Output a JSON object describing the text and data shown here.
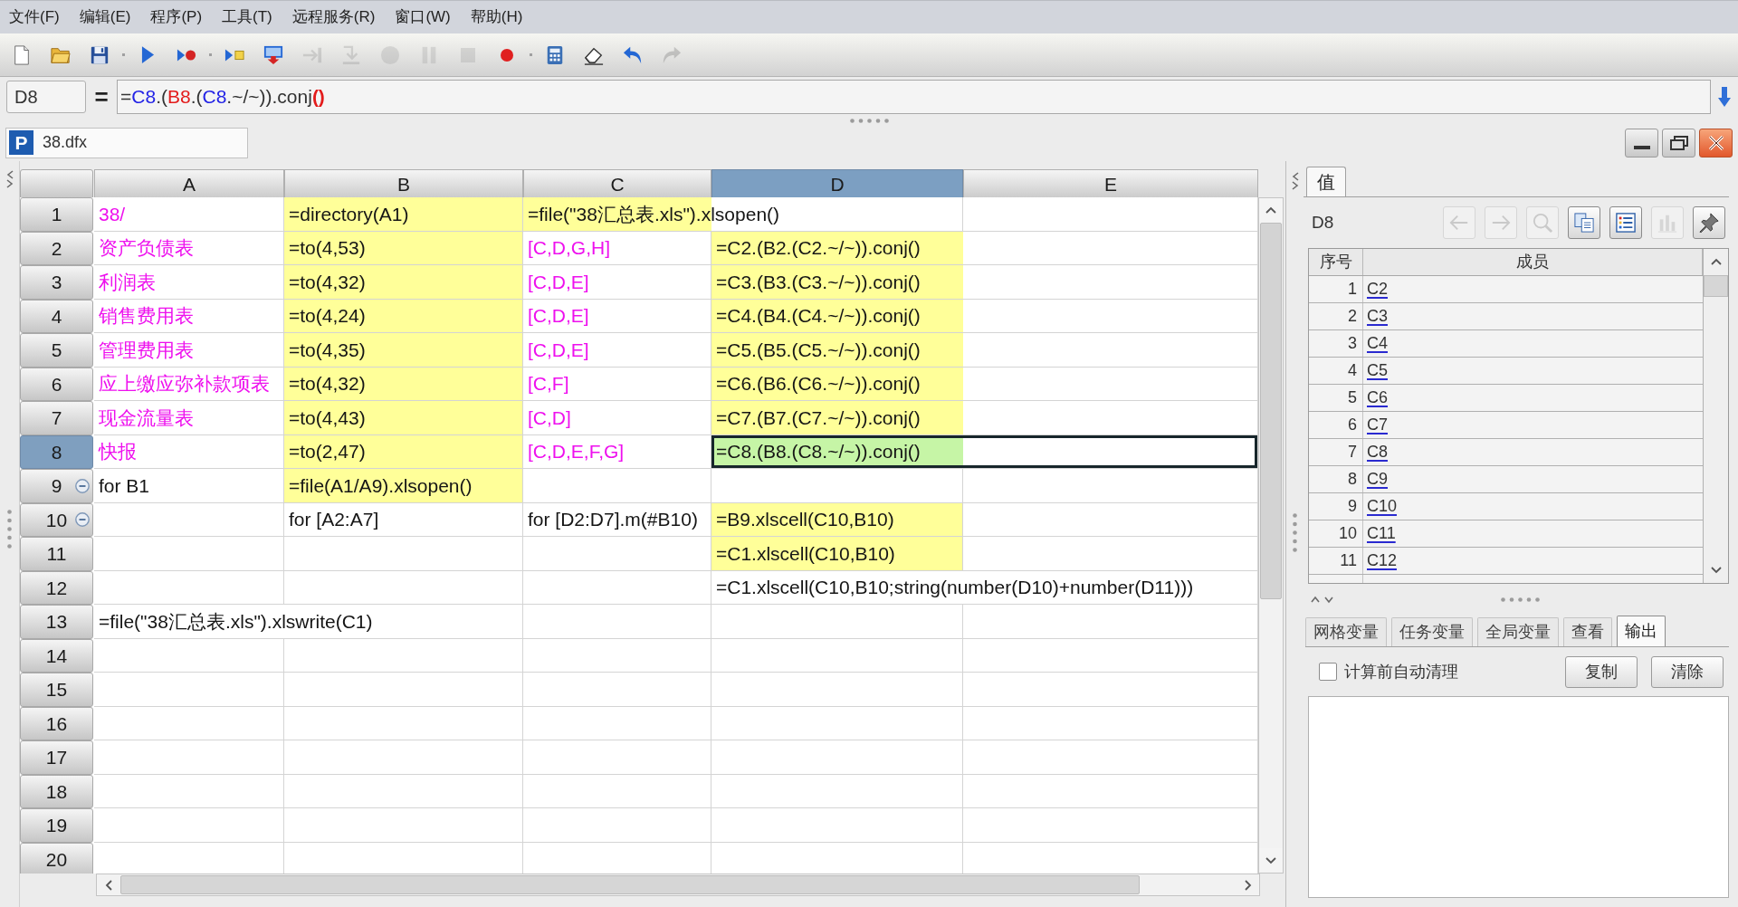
{
  "menu_bar": [
    "文件(F)",
    "编辑(E)",
    "程序(P)",
    "工具(T)",
    "远程服务(R)",
    "窗口(W)",
    "帮助(H)"
  ],
  "toolbar": [
    {
      "disabled": false
    },
    {
      "disabled": false
    },
    {
      "disabled": false
    },
    {
      "disabled": false
    },
    {
      "disabled": false
    },
    {
      "disabled": false
    },
    {
      "disabled": false
    },
    {
      "disabled": true
    },
    {
      "disabled": true
    },
    {
      "disabled": true
    },
    {
      "disabled": true
    },
    {
      "disabled": true
    },
    {
      "disabled": false
    },
    {
      "disabled": false
    },
    {
      "disabled": false
    },
    {
      "disabled": false
    },
    {
      "disabled": true
    }
  ],
  "formula_bar": {
    "cell": "D8",
    "equals_sign": "=",
    "segments": [
      {
        "text": "=",
        "color": "#333333"
      },
      {
        "text": "C8",
        "color": "#2323e6"
      },
      {
        "text": ".(",
        "color": "#333333"
      },
      {
        "text": "B8",
        "color": "#e31b1b"
      },
      {
        "text": ".(",
        "color": "#333333"
      },
      {
        "text": "C8",
        "color": "#2323e6"
      },
      {
        "text": ".~/~)).conj",
        "color": "#333333"
      },
      {
        "text": "**()**",
        "color": "#e31b1b"
      }
    ]
  },
  "document_tab": {
    "logo": "P",
    "title": "38.dfx"
  },
  "grid": {
    "columns": [
      {
        "label": "A",
        "selected": false
      },
      {
        "label": "B",
        "selected": false
      },
      {
        "label": "C",
        "selected": false
      },
      {
        "label": "D",
        "selected": true
      },
      {
        "label": "E",
        "selected": false
      }
    ],
    "rows": [
      {
        "label": "1",
        "selected": false,
        "cells": [
          {
            "text": "38/",
            "kind": "constant",
            "selected": false
          },
          {
            "text": "=directory(A1)",
            "kind": "calculation",
            "selected": false
          },
          {
            "text": "=file(\"38汇总表.xls\").xlsopen()",
            "kind": "calculation",
            "selected": false
          }
        ]
      },
      {
        "label": "2",
        "selected": false,
        "cells": [
          {
            "text": "资产负债表",
            "kind": "constant",
            "selected": false
          },
          {
            "text": "=to(4,53)",
            "kind": "calculation",
            "selected": false
          },
          {
            "text": "[C,D,G,H]",
            "kind": "constant",
            "selected": false
          },
          {
            "text": "=C2.(B2.(C2.~/~)).conj()",
            "kind": "calculation",
            "selected": false
          }
        ]
      },
      {
        "label": "3",
        "selected": false,
        "cells": [
          {
            "text": "利润表",
            "kind": "constant",
            "selected": false
          },
          {
            "text": "=to(4,32)",
            "kind": "calculation",
            "selected": false
          },
          {
            "text": "[C,D,E]",
            "kind": "constant",
            "selected": false
          },
          {
            "text": "=C3.(B3.(C3.~/~)).conj()",
            "kind": "calculation",
            "selected": false
          }
        ]
      },
      {
        "label": "4",
        "selected": false,
        "cells": [
          {
            "text": "销售费用表",
            "kind": "constant",
            "selected": false
          },
          {
            "text": "=to(4,24)",
            "kind": "calculation",
            "selected": false
          },
          {
            "text": "[C,D,E]",
            "kind": "constant",
            "selected": false
          },
          {
            "text": "=C4.(B4.(C4.~/~)).conj()",
            "kind": "calculation",
            "selected": false
          }
        ]
      },
      {
        "label": "5",
        "selected": false,
        "cells": [
          {
            "text": "管理费用表",
            "kind": "constant",
            "selected": false
          },
          {
            "text": "=to(4,35)",
            "kind": "calculation",
            "selected": false
          },
          {
            "text": "[C,D,E]",
            "kind": "constant",
            "selected": false
          },
          {
            "text": "=C5.(B5.(C5.~/~)).conj()",
            "kind": "calculation",
            "selected": false
          }
        ]
      },
      {
        "label": "6",
        "selected": false,
        "cells": [
          {
            "text": "应上缴应弥补款项表",
            "kind": "constant",
            "selected": false
          },
          {
            "text": "=to(4,32)",
            "kind": "calculation",
            "selected": false
          },
          {
            "text": "[C,F]",
            "kind": "constant",
            "selected": false
          },
          {
            "text": "=C6.(B6.(C6.~/~)).conj()",
            "kind": "calculation",
            "selected": false
          }
        ]
      },
      {
        "label": "7",
        "selected": false,
        "cells": [
          {
            "text": "现金流量表",
            "kind": "constant",
            "selected": false
          },
          {
            "text": "=to(4,43)",
            "kind": "calculation",
            "selected": false
          },
          {
            "text": "[C,D]",
            "kind": "constant",
            "selected": false
          },
          {
            "text": "=C7.(B7.(C7.~/~)).conj()",
            "kind": "calculation",
            "selected": false
          }
        ]
      },
      {
        "label": "8",
        "selected": true,
        "cells": [
          {
            "text": "快报",
            "kind": "constant",
            "selected": false
          },
          {
            "text": "=to(2,47)",
            "kind": "calculation",
            "selected": false
          },
          {
            "text": "[C,D,E,F,G]",
            "kind": "constant",
            "selected": false
          },
          {
            "text": "=C8.(B8.(C8.~/~)).conj()",
            "kind": "calculation",
            "selected": true
          }
        ]
      },
      {
        "label": "9",
        "selected": false,
        "fold": {
          "expanded": true
        },
        "cells": [
          {
            "text": "for B1",
            "kind": "statement",
            "selected": false
          },
          {
            "text": "=file(A1/A9).xlsopen()",
            "kind": "calculation",
            "selected": false
          }
        ]
      },
      {
        "label": "10",
        "selected": false,
        "fold": {
          "expanded": true
        },
        "cells": [
          null,
          {
            "text": "for [A2:A7]",
            "kind": "statement",
            "selected": false
          },
          {
            "text": "for [D2:D7].m(#B10)",
            "kind": "statement",
            "selected": false
          },
          {
            "text": "=B9.xlscell(C10,B10)",
            "kind": "calculation",
            "selected": false
          }
        ]
      },
      {
        "label": "11",
        "selected": false,
        "cells": [
          null,
          null,
          null,
          {
            "text": "=C1.xlscell(C10,B10)",
            "kind": "calculation",
            "selected": false
          }
        ]
      },
      {
        "label": "12",
        "selected": false,
        "cells": [
          null,
          null,
          null,
          {
            "text": "=C1.xlscell(C10,B10;string(number(D10)+number(D11)))",
            "kind": "statement",
            "selected": false
          }
        ]
      },
      {
        "label": "13",
        "selected": false,
        "cells": [
          {
            "text": "=file(\"38汇总表.xls\").xlswrite(C1)",
            "kind": "statement",
            "selected": false
          }
        ]
      },
      {
        "label": "14",
        "selected": false
      },
      {
        "label": "15",
        "selected": false
      },
      {
        "label": "16",
        "selected": false
      },
      {
        "label": "17",
        "selected": false
      },
      {
        "label": "18",
        "selected": false
      },
      {
        "label": "19",
        "selected": false
      },
      {
        "label": "20",
        "selected": false
      }
    ]
  },
  "value_panel": {
    "tabs": [
      {
        "label": "值",
        "selected": true
      }
    ],
    "cell": "D8",
    "toolbar": [
      {
        "disabled": true
      },
      {
        "disabled": true
      },
      {
        "disabled": true
      },
      {
        "disabled": false
      },
      {
        "disabled": false
      },
      {
        "disabled": true
      },
      {
        "disabled": false
      }
    ],
    "table": {
      "columns": [
        "序号",
        "成员"
      ],
      "rows": [
        {
          "index": "1",
          "member": "C2"
        },
        {
          "index": "2",
          "member": "C3"
        },
        {
          "index": "3",
          "member": "C4"
        },
        {
          "index": "4",
          "member": "C5"
        },
        {
          "index": "5",
          "member": "C6"
        },
        {
          "index": "6",
          "member": "C7"
        },
        {
          "index": "7",
          "member": "C8"
        },
        {
          "index": "8",
          "member": "C9"
        },
        {
          "index": "9",
          "member": "C10"
        },
        {
          "index": "10",
          "member": "C11"
        },
        {
          "index": "11",
          "member": "C12"
        }
      ]
    }
  },
  "output_panel": {
    "tabs": [
      {
        "label": "网格变量",
        "selected": false
      },
      {
        "label": "任务变量",
        "selected": false
      },
      {
        "label": "全局变量",
        "selected": false
      },
      {
        "label": "查看",
        "selected": false
      },
      {
        "label": "输出",
        "selected": true
      }
    ],
    "auto_clear": {
      "label": "计算前自动清理",
      "checked": false
    },
    "buttons": [
      "复制",
      "清除"
    ]
  }
}
